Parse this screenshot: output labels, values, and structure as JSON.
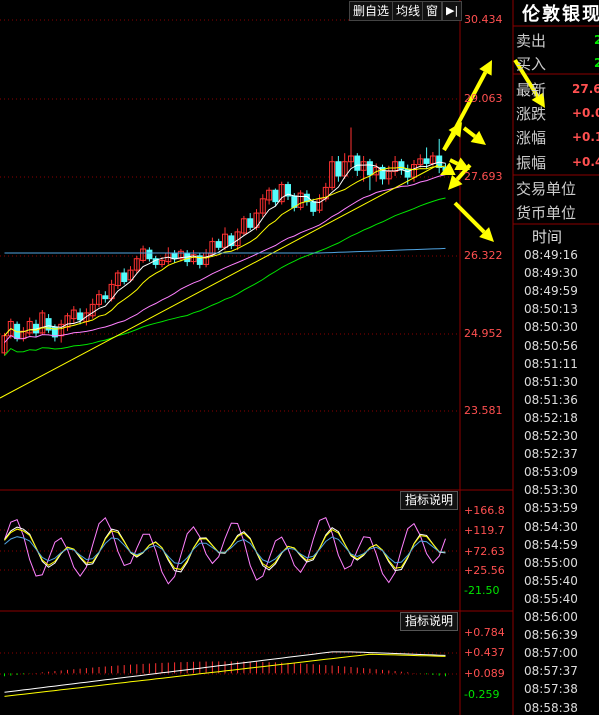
{
  "toolbar": {
    "delete_watchlist_label": "删自选",
    "ma_label": "均线",
    "window_label": "窗",
    "next_icon": "play-forward-icon"
  },
  "main_panel": {
    "price_labels": [
      "30.434",
      "29.063",
      "27.693",
      "26.322",
      "24.952",
      "23.581"
    ]
  },
  "indicator1": {
    "button_label": "指标说明",
    "labels": [
      "+166.8",
      "+119.7",
      "+72.63",
      "+25.56",
      "-21.50"
    ]
  },
  "indicator2": {
    "button_label": "指标说明",
    "labels": [
      "+0.784",
      "+0.437",
      "+0.089",
      "-0.259"
    ]
  },
  "quote": {
    "title": "伦敦银现",
    "sell_label": "卖出",
    "sell_value": "2",
    "buy_label": "买入",
    "buy_value": "2",
    "last_label": "最新",
    "last_value": "27.6",
    "change_label": "涨跌",
    "change_value": "+0.0",
    "change_pct_label": "涨幅",
    "change_pct_value": "+0.1",
    "amplitude_label": "振幅",
    "amplitude_value": "+0.4",
    "trade_unit_label": "交易单位",
    "currency_unit_label": "货币单位"
  },
  "ticks": {
    "header": "时间",
    "times": [
      "08:49:16",
      "08:49:30",
      "08:49:59",
      "08:50:13",
      "08:50:30",
      "08:50:56",
      "08:51:11",
      "08:51:30",
      "08:51:36",
      "08:52:18",
      "08:52:30",
      "08:52:37",
      "08:53:09",
      "08:53:30",
      "08:53:59",
      "08:54:30",
      "08:54:59",
      "08:55:00",
      "08:55:40",
      "08:55:40",
      "08:56:00",
      "08:56:39",
      "08:57:00",
      "08:57:37",
      "08:57:38",
      "08:58:38"
    ]
  },
  "colors": {
    "up": "#ff3232",
    "down": "#54fcfc",
    "grid": "#8b0000",
    "axis_text": "#ff5050",
    "ma5": "#ffffff",
    "ma10": "#ffff00",
    "ma20": "#ff80ff",
    "ma30": "#00e600",
    "ma60": "#4fa3e0",
    "arrow": "#ffff00"
  },
  "candles": [
    [
      24.6,
      24.9,
      24.55,
      24.95
    ],
    [
      24.9,
      25.15,
      24.85,
      25.2
    ],
    [
      25.1,
      24.85,
      24.8,
      25.15
    ],
    [
      24.85,
      24.98,
      24.8,
      25.05
    ],
    [
      24.95,
      25.15,
      24.9,
      25.22
    ],
    [
      25.1,
      24.95,
      24.88,
      25.18
    ],
    [
      24.95,
      25.3,
      24.92,
      25.35
    ],
    [
      25.2,
      25.0,
      24.95,
      25.28
    ],
    [
      25.05,
      24.88,
      24.8,
      25.1
    ],
    [
      24.9,
      25.1,
      24.78,
      25.18
    ],
    [
      25.05,
      25.25,
      24.98,
      25.3
    ],
    [
      25.2,
      25.35,
      25.1,
      25.42
    ],
    [
      25.3,
      25.18,
      25.1,
      25.38
    ],
    [
      25.15,
      25.3,
      25.08,
      25.38
    ],
    [
      25.25,
      25.45,
      25.2,
      25.55
    ],
    [
      25.45,
      25.62,
      25.4,
      25.7
    ],
    [
      25.6,
      25.55,
      25.48,
      25.68
    ],
    [
      25.55,
      25.8,
      25.5,
      25.88
    ],
    [
      25.78,
      26.0,
      25.72,
      26.05
    ],
    [
      26.0,
      25.85,
      25.8,
      26.08
    ],
    [
      25.88,
      26.05,
      25.84,
      26.12
    ],
    [
      26.05,
      26.25,
      26.0,
      26.3
    ],
    [
      26.22,
      26.42,
      26.18,
      26.48
    ],
    [
      26.4,
      26.25,
      26.2,
      26.45
    ],
    [
      26.25,
      26.15,
      26.08,
      26.3
    ],
    [
      26.15,
      26.22,
      26.1,
      26.28
    ],
    [
      26.2,
      26.35,
      26.15,
      26.45
    ],
    [
      26.35,
      26.25,
      26.18,
      26.4
    ],
    [
      26.25,
      26.38,
      26.2,
      26.42
    ],
    [
      26.35,
      26.2,
      26.12,
      26.4
    ],
    [
      26.2,
      26.32,
      26.15,
      26.4
    ],
    [
      26.3,
      26.15,
      26.08,
      26.35
    ],
    [
      26.15,
      26.35,
      26.1,
      26.42
    ],
    [
      26.33,
      26.55,
      26.28,
      26.62
    ],
    [
      26.55,
      26.45,
      26.4,
      26.6
    ],
    [
      26.45,
      26.68,
      26.4,
      26.8
    ],
    [
      26.65,
      26.48,
      26.42,
      26.7
    ],
    [
      26.48,
      26.72,
      26.4,
      26.78
    ],
    [
      26.7,
      26.95,
      26.65,
      27.0
    ],
    [
      26.95,
      26.8,
      26.75,
      27.05
    ],
    [
      26.8,
      27.05,
      26.75,
      27.12
    ],
    [
      27.05,
      27.3,
      26.98,
      27.38
    ],
    [
      27.28,
      27.45,
      27.2,
      27.5
    ],
    [
      27.45,
      27.25,
      27.18,
      27.48
    ],
    [
      27.25,
      27.55,
      27.2,
      27.6
    ],
    [
      27.55,
      27.35,
      27.28,
      27.6
    ],
    [
      27.35,
      27.15,
      27.08,
      27.4
    ],
    [
      27.15,
      27.4,
      27.1,
      27.45
    ],
    [
      27.38,
      27.25,
      27.18,
      27.45
    ],
    [
      27.25,
      27.08,
      27.0,
      27.3
    ],
    [
      27.1,
      27.3,
      27.05,
      27.38
    ],
    [
      27.3,
      27.5,
      27.25,
      27.58
    ],
    [
      27.5,
      27.95,
      27.45,
      28.05
    ],
    [
      27.95,
      27.7,
      27.6,
      28.05
    ],
    [
      27.7,
      27.95,
      27.65,
      28.1
    ],
    [
      27.95,
      28.05,
      27.85,
      28.55
    ],
    [
      28.05,
      27.8,
      27.7,
      28.1
    ],
    [
      27.8,
      27.95,
      27.6,
      28.05
    ],
    [
      27.95,
      27.72,
      27.45,
      28.0
    ],
    [
      27.72,
      27.85,
      27.6,
      27.92
    ],
    [
      27.85,
      27.65,
      27.55,
      27.9
    ],
    [
      27.65,
      27.78,
      27.55,
      27.88
    ],
    [
      27.78,
      27.95,
      27.7,
      28.05
    ],
    [
      27.95,
      27.82,
      27.72,
      28.0
    ],
    [
      27.82,
      27.68,
      27.55,
      27.9
    ],
    [
      27.68,
      27.9,
      27.6,
      27.98
    ],
    [
      27.9,
      28.0,
      27.85,
      28.08
    ],
    [
      28.0,
      27.92,
      27.82,
      28.2
    ],
    [
      27.92,
      28.05,
      27.88,
      28.12
    ],
    [
      28.05,
      27.85,
      27.75,
      28.35
    ],
    [
      27.85,
      27.8,
      27.72,
      27.92
    ]
  ]
}
